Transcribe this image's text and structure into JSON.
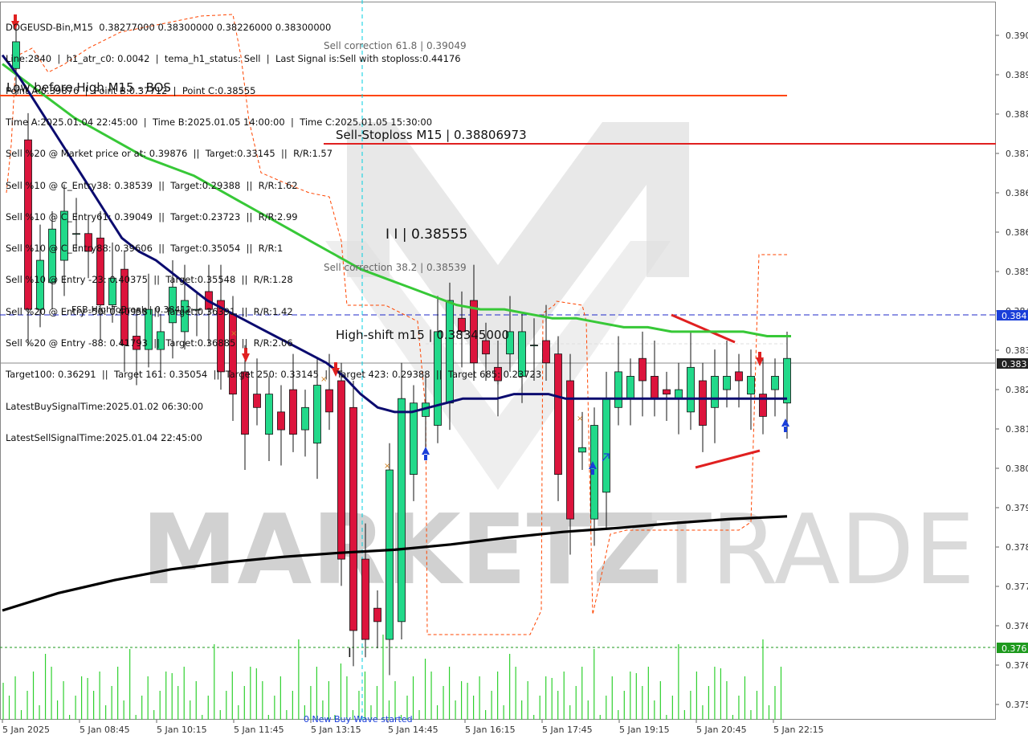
{
  "chart": {
    "symbol_line": "DOGEUSD-Bin,M15  0.38277000 0.38300000 0.38226000 0.38300000",
    "indicator_lines": [
      "Line:2840  |  h1_atr_c0: 0.0042  |  tema_h1_status: Sell  |  Last Signal is:Sell with stoploss:0.44176",
      "Point A:0.39876  |  Point B:0.37712  |  Point C:0.38555",
      "Time A:2025.01.04 22:45:00  |  Time B:2025.01.05 14:00:00  |  Time C:2025.01.05 15:30:00",
      "Sell %20 @ Market price or at: 0.39876  ||  Target:0.33145  ||  R/R:1.57",
      "Sell %10 @ C_Entry38: 0.38539  ||  Target:0.29388  ||  R/R:1.62",
      "Sell %10 @ C_Entry61: 0.39049  ||  Target:0.23723  ||  R/R:2.99",
      "Sell %10 @ C_Entry88: 0.39606  ||  Target:0.35054  ||  R/R:1",
      "Sell %10 @ Entry -23: 0.40375  ||  Target:0.35548  ||  R/R:1.28",
      "Sell %20 @ Entry -50: 0.40958  ||  Target:0.36391  ||  R/R:1.42",
      "Sell %20 @ Entry -88: 0.41793  ||  Target:0.36885  ||  R/R:2.06",
      "Target100: 0.36291  ||  Target 161: 0.35054  ||  Target 250: 0.33145  ||  Target 423: 0.29388  ||  Target 685: 0.23723",
      "LatestBuySignalTime:2025.01.02 06:30:00",
      "LatestSellSignalTime:2025.01.04 22:45:00"
    ],
    "low_before_high_label": "Low before High  M15 - BOS",
    "price_axis": [
      "0.390",
      "0.389",
      "0.388",
      "0.387",
      "0.386",
      "0.386",
      "0.385",
      "0.384",
      "0.383",
      "0.382",
      "0.381",
      "0.380",
      "0.379",
      "0.378",
      "0.377",
      "0.376",
      "0.376",
      "0.375"
    ],
    "time_axis": [
      "5 Jan 2025",
      "5 Jan 08:45",
      "5 Jan 10:15",
      "5 Jan 11:45",
      "5 Jan 13:15",
      "5 Jan 14:45",
      "5 Jan 16:15",
      "5 Jan 17:45",
      "5 Jan 19:15",
      "5 Jan 20:45",
      "5 Jan 22:15"
    ],
    "price_tags": {
      "high_to_break": "0.384",
      "current": "0.383",
      "low_line": "0.376"
    },
    "labels": {
      "sell_correction_61": "Sell correction 61.8 | 0.39049",
      "sell_stoploss": "Sell-Stoploss M15 | 0.38806973",
      "point_c": "I I | 0.38555",
      "sell_correction_38": "Sell correction 38.2 | 0.38539",
      "fsb_high": "FSB-HighToBreak | 0.38412",
      "high_shift": "High-shift m15 | 0.38345000",
      "low_marker": "I",
      "bottom_note": "0 New Buy Wave started"
    },
    "watermark": {
      "left": "MARKETZ",
      "right": "TRADE"
    },
    "colors": {
      "bull": "#22d98a",
      "bear": "#dc143c",
      "ma_fast": "#0b0b6f",
      "ma_slow": "#37c837",
      "ma_long": "#000000",
      "stoploss": "#e02020",
      "orange_line": "#ff4500",
      "blue_dash": "#1f28c8",
      "green_dot": "#1e9a1e",
      "volume": "#2ed02e",
      "tag_blue": "#1a3fd9",
      "tag_dark": "#222222",
      "tag_green": "#1e9a1e"
    }
  },
  "chart_data": {
    "type": "candlestick",
    "timeframe": "M15",
    "symbol": "DOGEUSD-Bin",
    "open": [
      0.3892,
      0.3876,
      0.3838,
      0.3844,
      0.3849,
      0.3855,
      0.3855,
      0.3854,
      0.3839,
      0.3847,
      0.3832,
      0.3829,
      0.3829,
      0.3835,
      0.3833,
      0.3838,
      0.3842,
      0.384,
      0.3837,
      0.3824,
      0.3819,
      0.381,
      0.3815,
      0.382,
      0.3811,
      0.3808,
      0.382,
      0.3822,
      0.3816,
      0.3782,
      0.3771,
      0.3764,
      0.3768,
      0.3801,
      0.3814,
      0.3812,
      0.3817,
      0.3836,
      0.384,
      0.3831,
      0.3825,
      0.3828,
      0.3823,
      0.383,
      0.3831,
      0.3828,
      0.3822,
      0.3806,
      0.3791,
      0.3797,
      0.3816,
      0.3818,
      0.3827,
      0.3823,
      0.382,
      0.3818,
      0.3815,
      0.3822,
      0.3816,
      0.382,
      0.3824,
      0.3819,
      0.3819,
      0.382,
      0.3817
    ],
    "close": [
      0.3898,
      0.3838,
      0.3849,
      0.3856,
      0.386,
      0.3855,
      0.3851,
      0.3839,
      0.3845,
      0.383,
      0.3829,
      0.3838,
      0.3833,
      0.3843,
      0.384,
      0.3838,
      0.3838,
      0.3824,
      0.3819,
      0.381,
      0.3816,
      0.3819,
      0.3811,
      0.381,
      0.3816,
      0.3821,
      0.3815,
      0.3782,
      0.3766,
      0.3764,
      0.3768,
      0.3802,
      0.3818,
      0.3817,
      0.3817,
      0.3833,
      0.384,
      0.3833,
      0.3826,
      0.3828,
      0.3822,
      0.3833,
      0.3833,
      0.383,
      0.3826,
      0.3801,
      0.3791,
      0.3807,
      0.3812,
      0.3818,
      0.3824,
      0.3823,
      0.3822,
      0.3818,
      0.3819,
      0.382,
      0.3825,
      0.3812,
      0.3823,
      0.3823,
      0.3822,
      0.3823,
      0.3814,
      0.3823,
      0.3827
    ],
    "ma_fast": [
      0.3895,
      0.389,
      0.3884,
      0.3878,
      0.3872,
      0.3866,
      0.386,
      0.3854,
      0.3851,
      0.3849,
      0.3846,
      0.3843,
      0.384,
      0.3838,
      0.3836,
      0.3834,
      0.3832,
      0.383,
      0.3828,
      0.3826,
      0.3823,
      0.3819,
      0.3816,
      0.3815,
      0.3815,
      0.3816,
      0.3817,
      0.3818,
      0.3818,
      0.3818,
      0.3819,
      0.3819,
      0.3819,
      0.3818,
      0.3818,
      0.3818,
      0.3818,
      0.3818,
      0.3818,
      0.3818,
      0.3818,
      0.3818,
      0.3818,
      0.3818,
      0.3818,
      0.3818,
      0.3818
    ],
    "ma_slow": [
      0.3893,
      0.3889,
      0.3885,
      0.3881,
      0.3878,
      0.3875,
      0.3872,
      0.387,
      0.3868,
      0.3865,
      0.3862,
      0.3859,
      0.3856,
      0.3853,
      0.385,
      0.3847,
      0.3845,
      0.3843,
      0.3841,
      0.3839,
      0.3838,
      0.3838,
      0.3837,
      0.3836,
      0.3836,
      0.3835,
      0.3834,
      0.3834,
      0.3833,
      0.3833,
      0.3833,
      0.3833,
      0.3832,
      0.3832
    ],
    "ma_long": [
      0.37705,
      0.37744,
      0.37773,
      0.37797,
      0.37813,
      0.37825,
      0.37834,
      0.37841,
      0.37853,
      0.37868,
      0.37881,
      0.3789,
      0.37901,
      0.3791,
      0.37916
    ],
    "levels": {
      "sell_correction_61_8": 0.39049,
      "sell_stoploss_m15": 0.38806973,
      "point_c": 0.38555,
      "sell_correction_38_2": 0.38539,
      "fsb_high_to_break": 0.38412,
      "high_shift_m15": 0.38345,
      "current": 0.383,
      "low_line": 0.3763
    },
    "ylim": [
      0.3746,
      0.3907
    ],
    "x_ticks": [
      "5 Jan 2025",
      "5 Jan 08:45",
      "5 Jan 10:15",
      "5 Jan 11:45",
      "5 Jan 13:15",
      "5 Jan 14:45",
      "5 Jan 16:15",
      "5 Jan 17:45",
      "5 Jan 19:15",
      "5 Jan 20:45",
      "5 Jan 22:15"
    ]
  }
}
